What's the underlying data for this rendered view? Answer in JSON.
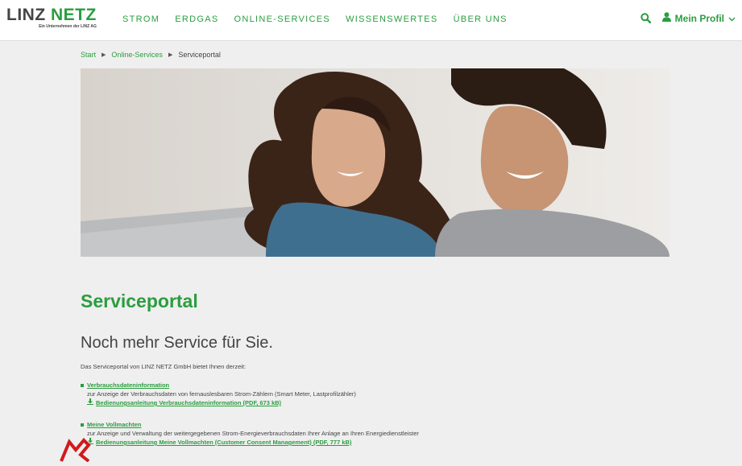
{
  "header": {
    "logo": {
      "part1": "LINZ",
      "part2": "NETZ",
      "tagline": "Ein Unternehmen der LINZ AG"
    },
    "nav": [
      "STROM",
      "ERDGAS",
      "ONLINE-SERVICES",
      "WISSENSWERTES",
      "ÜBER UNS"
    ],
    "search_icon": "search-icon",
    "profile_label": "Mein Profil",
    "profile_icon": "user-icon",
    "chevron_icon": "chevron-down-icon"
  },
  "breadcrumb": {
    "items": [
      "Start",
      "Online-Services"
    ],
    "current": "Serviceportal"
  },
  "hero": {
    "image": "photo of couple looking at a laptop"
  },
  "main": {
    "title": "Serviceportal",
    "subtitle": "Noch mehr Service für Sie.",
    "intro": "Das Serviceportal von LINZ NETZ GmbH bietet Ihnen derzeit:",
    "services": [
      {
        "title": "Verbrauchsdateninformation",
        "desc": "zur Anzeige der Verbrauchsdaten von fernauslesbaren Strom-Zählern (Smart Meter, Lastprofilzähler)",
        "download": "Bedienungsanleitung Verbrauchsdateninformation (PDF, 673 kB)"
      },
      {
        "title": "Meine Vollmachten",
        "desc": "zur Anzeige und Verwaltung der weitergegebenen Strom-Energieverbrauchsdaten Ihrer Anlage an Ihren Energiedienstleister",
        "download": "Bedienungsanleitung Meine Vollmachten (Customer Consent Management) (PDF, 777 kB)"
      }
    ]
  },
  "colors": {
    "accent": "#2a9d3f",
    "text": "#444444",
    "background": "#efefef"
  }
}
